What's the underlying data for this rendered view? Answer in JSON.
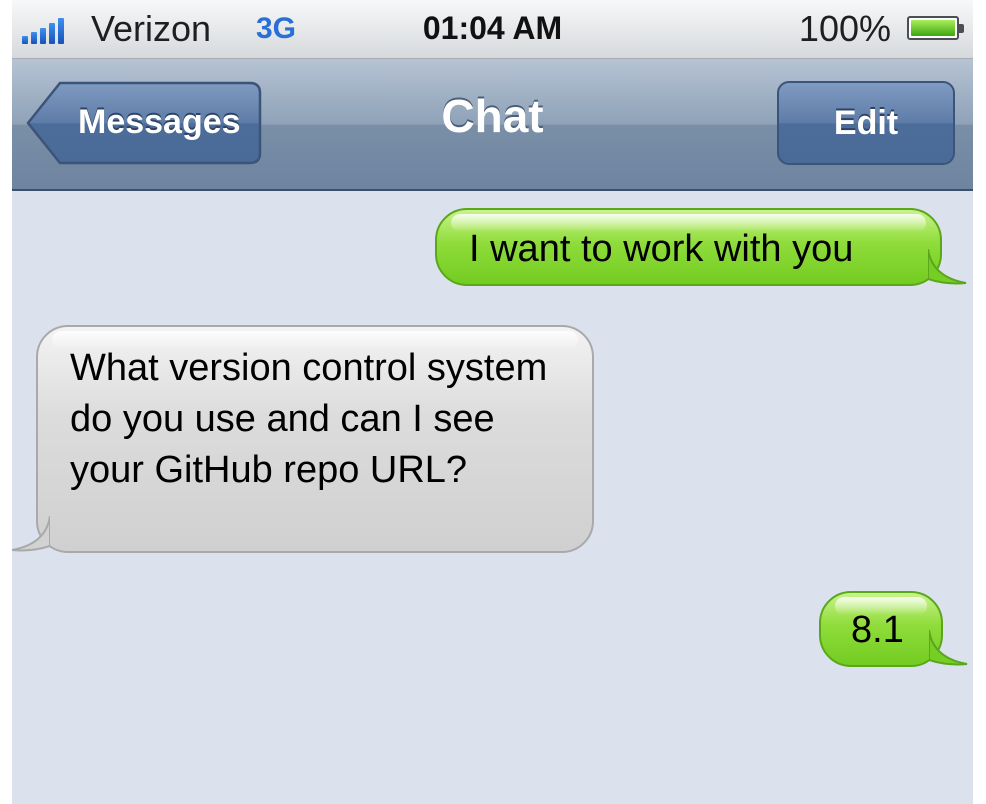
{
  "status_bar": {
    "carrier": "Verizon",
    "network": "3G",
    "time": "01:04 AM",
    "battery_percent": "100%",
    "signal_bars": 5,
    "battery_level": 1.0
  },
  "nav_bar": {
    "back_label": "Messages",
    "title": "Chat",
    "edit_label": "Edit"
  },
  "messages": [
    {
      "direction": "sent",
      "text": "I want to work with you"
    },
    {
      "direction": "received",
      "text": "What version control system do you use and can I see your GitHub repo URL?"
    },
    {
      "direction": "sent",
      "text": "8.1"
    }
  ],
  "colors": {
    "sent_bubble": "#8fdc3a",
    "received_bubble": "#d8d8d8",
    "chat_background": "#dbe2ed",
    "nav_bar": "#7a8fa7",
    "network_label": "#2a6fd6"
  }
}
